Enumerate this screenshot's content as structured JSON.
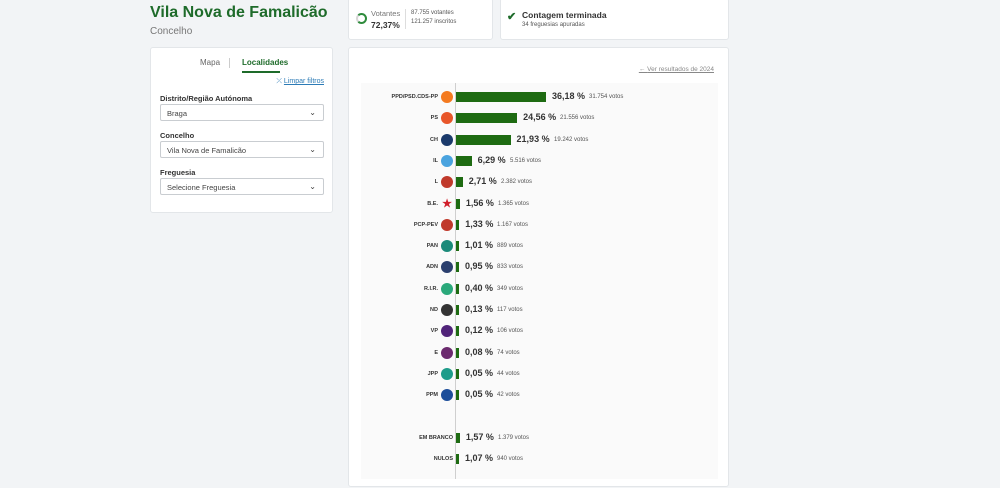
{
  "header": {
    "title": "Vila Nova de Famalicão",
    "subtitle": "Concelho"
  },
  "filters": {
    "tab_map": "Mapa",
    "tab_localities": "Localidades",
    "clear": "Limpar filtros",
    "district_label": "Distrito/Região Autónoma",
    "district_value": "Braga",
    "municipality_label": "Concelho",
    "municipality_value": "Vila Nova de Famalicão",
    "parish_label": "Freguesia",
    "parish_value": "Selecione Freguesia"
  },
  "stats": {
    "voters_label": "Votantes",
    "voters_pct": "72,37%",
    "voters_count": "87.755 votantes",
    "registered_count": "121.257 inscritos",
    "count_title": "Contagem terminada",
    "count_sub": "34 freguesias apuradas"
  },
  "results": {
    "previous_link": "Ver resultados de 2024",
    "max_pct": 36.18,
    "colors": {
      "bar": "#1e6b12",
      "accent": "#1e6b2a"
    }
  },
  "chart_data": {
    "type": "bar",
    "orientation": "horizontal",
    "categories": [
      "PPD/PSD.CDS-PP",
      "PS",
      "CH",
      "IL",
      "L",
      "B.E.",
      "PCP-PEV",
      "PAN",
      "ADN",
      "R.I.R.",
      "ND",
      "VP",
      "E",
      "JPP",
      "PPM",
      "EM BRANCO",
      "NULOS"
    ],
    "values": [
      36.18,
      24.56,
      21.93,
      6.29,
      2.71,
      1.56,
      1.33,
      1.01,
      0.95,
      0.4,
      0.13,
      0.12,
      0.08,
      0.05,
      0.05,
      1.57,
      1.07
    ],
    "series": [
      {
        "values": [
          36.18,
          24.56,
          21.93,
          6.29,
          2.71,
          1.56,
          1.33,
          1.01,
          0.95,
          0.4,
          0.13,
          0.12,
          0.08,
          0.05,
          0.05,
          1.57,
          1.07
        ]
      }
    ],
    "rows": [
      {
        "party": "PPD/PSD.CDS-PP",
        "pct": 36.18,
        "pct_label": "36,18 %",
        "votes_label": "31.754 votos",
        "icon": "psd-cds-logo-icon",
        "icon_color": "#f47a20",
        "icon_text": "",
        "group": 0
      },
      {
        "party": "PS",
        "pct": 24.56,
        "pct_label": "24,56 %",
        "votes_label": "21.556 votos",
        "icon": "ps-logo-icon",
        "icon_color": "#e8562a",
        "icon_text": "",
        "group": 0
      },
      {
        "party": "CH",
        "pct": 21.93,
        "pct_label": "21,93 %",
        "votes_label": "19.242 votos",
        "icon": "chega-logo-icon",
        "icon_color": "#1b3a6b",
        "icon_text": "",
        "group": 0
      },
      {
        "party": "IL",
        "pct": 6.29,
        "pct_label": "6,29 %",
        "votes_label": "5.516 votos",
        "icon": "il-logo-icon",
        "icon_color": "#4aa3df",
        "icon_text": "",
        "group": 0
      },
      {
        "party": "L",
        "pct": 2.71,
        "pct_label": "2,71 %",
        "votes_label": "2.382 votos",
        "icon": "livre-logo-icon",
        "icon_color": "#c0392b",
        "icon_text": "",
        "group": 0
      },
      {
        "party": "B.E.",
        "pct": 1.56,
        "pct_label": "1,56 %",
        "votes_label": "1.365 votos",
        "icon": "be-star-logo-icon",
        "icon_color": "#d11f2a",
        "icon_text": "★",
        "group": 0
      },
      {
        "party": "PCP-PEV",
        "pct": 1.33,
        "pct_label": "1,33 %",
        "votes_label": "1.167 votos",
        "icon": "cdu-logo-icon",
        "icon_color": "#c0392b",
        "icon_text": "",
        "group": 0
      },
      {
        "party": "PAN",
        "pct": 1.01,
        "pct_label": "1,01 %",
        "votes_label": "889 votos",
        "icon": "pan-logo-icon",
        "icon_color": "#1b8a7a",
        "icon_text": "",
        "group": 0
      },
      {
        "party": "ADN",
        "pct": 0.95,
        "pct_label": "0,95 %",
        "votes_label": "833 votos",
        "icon": "adn-logo-icon",
        "icon_color": "#2b3f6e",
        "icon_text": "",
        "group": 0
      },
      {
        "party": "R.I.R.",
        "pct": 0.4,
        "pct_label": "0,40 %",
        "votes_label": "349 votos",
        "icon": "rir-logo-icon",
        "icon_color": "#2aa87a",
        "icon_text": "",
        "group": 0
      },
      {
        "party": "ND",
        "pct": 0.13,
        "pct_label": "0,13 %",
        "votes_label": "117 votos",
        "icon": "nd-logo-icon",
        "icon_color": "#333333",
        "icon_text": "",
        "group": 0
      },
      {
        "party": "VP",
        "pct": 0.12,
        "pct_label": "0,12 %",
        "votes_label": "106 votos",
        "icon": "volt-logo-icon",
        "icon_color": "#502379",
        "icon_text": "",
        "group": 0
      },
      {
        "party": "E",
        "pct": 0.08,
        "pct_label": "0,08 %",
        "votes_label": "74 votos",
        "icon": "ergue-te-logo-icon",
        "icon_color": "#6b2a6e",
        "icon_text": "",
        "group": 0
      },
      {
        "party": "JPP",
        "pct": 0.05,
        "pct_label": "0,05 %",
        "votes_label": "44 votos",
        "icon": "jpp-logo-icon",
        "icon_color": "#1e9c8a",
        "icon_text": "",
        "group": 0
      },
      {
        "party": "PPM",
        "pct": 0.05,
        "pct_label": "0,05 %",
        "votes_label": "42 votos",
        "icon": "ppm-logo-icon",
        "icon_color": "#1d4e9a",
        "icon_text": "",
        "group": 0
      },
      {
        "party": "EM BRANCO",
        "pct": 1.57,
        "pct_label": "1,57 %",
        "votes_label": "1.379 votos",
        "icon": "",
        "icon_color": "",
        "icon_text": "",
        "group": 1
      },
      {
        "party": "NULOS",
        "pct": 1.07,
        "pct_label": "1,07 %",
        "votes_label": "940 votos",
        "icon": "",
        "icon_color": "",
        "icon_text": "",
        "group": 1
      }
    ]
  }
}
